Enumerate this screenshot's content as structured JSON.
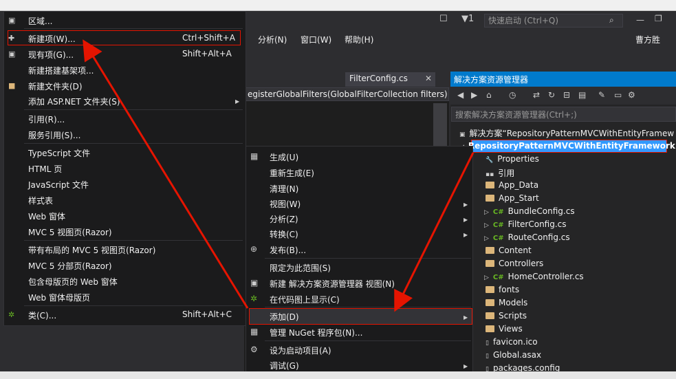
{
  "quicklaunch": {
    "placeholder": "快速启动 (Ctrl+Q)"
  },
  "notif_count": "1",
  "user": "曹方胜",
  "menubar": [
    "分析(N)",
    "窗口(W)",
    "帮助(H)"
  ],
  "editor": {
    "tab": "FilterConfig.cs",
    "nav": "egisterGlobalFilters(GlobalFilterCollection filters)"
  },
  "solution_explorer": {
    "title": "解决方案资源管理器",
    "search_placeholder": "搜索解决方案资源管理器(Ctrl+;)",
    "solution": "解决方案“RepositoryPatternMVCWithEntityFramew",
    "project": "RepositoryPatternMVCWithEntityFramework",
    "items": [
      "Properties",
      "引用",
      "App_Data",
      "App_Start",
      "BundleConfig.cs",
      "FilterConfig.cs",
      "RouteConfig.cs",
      "Content",
      "Controllers",
      "HomeController.cs",
      "fonts",
      "Models",
      "Scripts",
      "Views",
      "favicon.ico",
      "Global.asax",
      "packages.config"
    ]
  },
  "add_submenu": {
    "region": "区域...",
    "new_item": "新建项(W)...",
    "new_item_short": "Ctrl+Shift+A",
    "existing_item": "现有项(G)...",
    "existing_item_short": "Shift+Alt+A",
    "scaffold": "新建搭建基架项...",
    "new_folder": "新建文件夹(D)",
    "aspnet_folder": "添加 ASP.NET 文件夹(S)",
    "reference": "引用(R)...",
    "service_ref": "服务引用(S)...",
    "typescript": "TypeScript 文件",
    "html": "HTML 页",
    "javascript": "JavaScript 文件",
    "stylesheet": "样式表",
    "webform": "Web 窗体",
    "mvc_view": "MVC 5 视图页(Razor)",
    "mvc_layout_view": "带有布局的 MVC 5 视图页(Razor)",
    "mvc_partial": "MVC 5 分部页(Razor)",
    "webform_master": "包含母版页的 Web 窗体",
    "master_page": "Web 窗体母版页",
    "class": "类(C)...",
    "class_short": "Shift+Alt+C"
  },
  "context_menu": {
    "build": "生成(U)",
    "rebuild": "重新生成(E)",
    "clean": "清理(N)",
    "view": "视图(W)",
    "analyze": "分析(Z)",
    "convert": "转换(C)",
    "publish": "发布(B)...",
    "scope": "限定为此范围(S)",
    "new_view": "新建 解决方案资源管理器 视图(N)",
    "code_map": "在代码图上显示(C)",
    "add": "添加(D)",
    "nuget": "管理 NuGet 程序包(N)...",
    "startup": "设为启动项目(A)",
    "debug": "调试(G)"
  }
}
